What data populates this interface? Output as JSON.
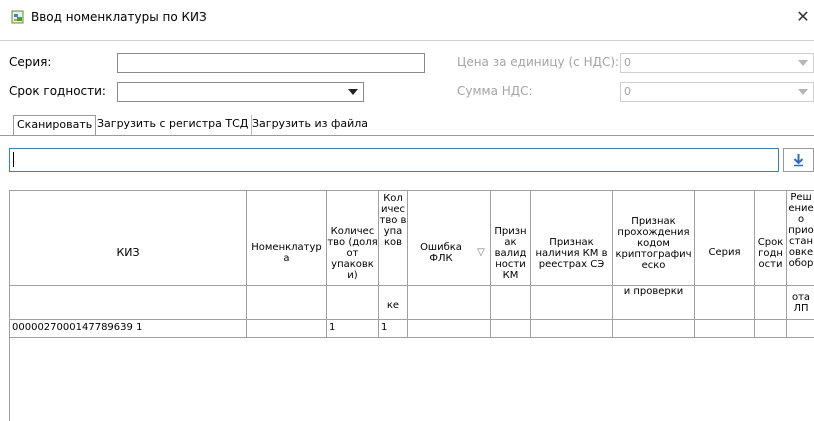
{
  "window": {
    "title": "Ввод номенклатуры по КИЗ",
    "close_glyph": "✕"
  },
  "form": {
    "series_label": "Серия:",
    "series_value": "",
    "expiry_label": "Срок годности:",
    "expiry_value": "",
    "price_label": "Цена за единицу (с НДС):",
    "price_value": "0",
    "vat_label": "Сумма НДС:",
    "vat_value": "0"
  },
  "tabs": [
    {
      "label": "Сканировать",
      "active": true
    },
    {
      "label": "Загрузить с регистра ТСД",
      "active": false
    },
    {
      "label": "Загрузить из файла",
      "active": false
    }
  ],
  "scan": {
    "value": "",
    "load_icon": "download-icon"
  },
  "grid": {
    "columns": [
      {
        "key": "kiz",
        "label": "КИЗ",
        "sub": ""
      },
      {
        "key": "nomenclature",
        "label": "Номенклатур а",
        "sub": ""
      },
      {
        "key": "qty_share",
        "label": "Количес тво (доля от упаковк и)",
        "sub": ""
      },
      {
        "key": "qty_packs",
        "label": "Кол ичес тво в упа ков",
        "sub": "ке"
      },
      {
        "key": "flk_error",
        "label": "Ошибка ФЛК",
        "sub": "",
        "filter_icon": "▽"
      },
      {
        "key": "km_valid",
        "label": "Призн ак валид ности КМ",
        "sub": ""
      },
      {
        "key": "km_registry",
        "label": "Признак наличия КМ в реестрах СЭ",
        "sub": ""
      },
      {
        "key": "crypto_check",
        "label": "Признак прохождения кодом криптографич еско",
        "sub": "и проверки"
      },
      {
        "key": "series",
        "label": "Серия",
        "sub": ""
      },
      {
        "key": "expiry",
        "label": "Срок годн ости",
        "sub": ""
      },
      {
        "key": "decision",
        "label": "Реш ение о прио стан овке обор",
        "sub": "ота ЛП"
      }
    ],
    "rows": [
      [
        "0000027000147789639 1",
        "",
        "1",
        "1",
        "",
        "",
        "",
        "",
        "",
        "",
        ""
      ]
    ]
  }
}
